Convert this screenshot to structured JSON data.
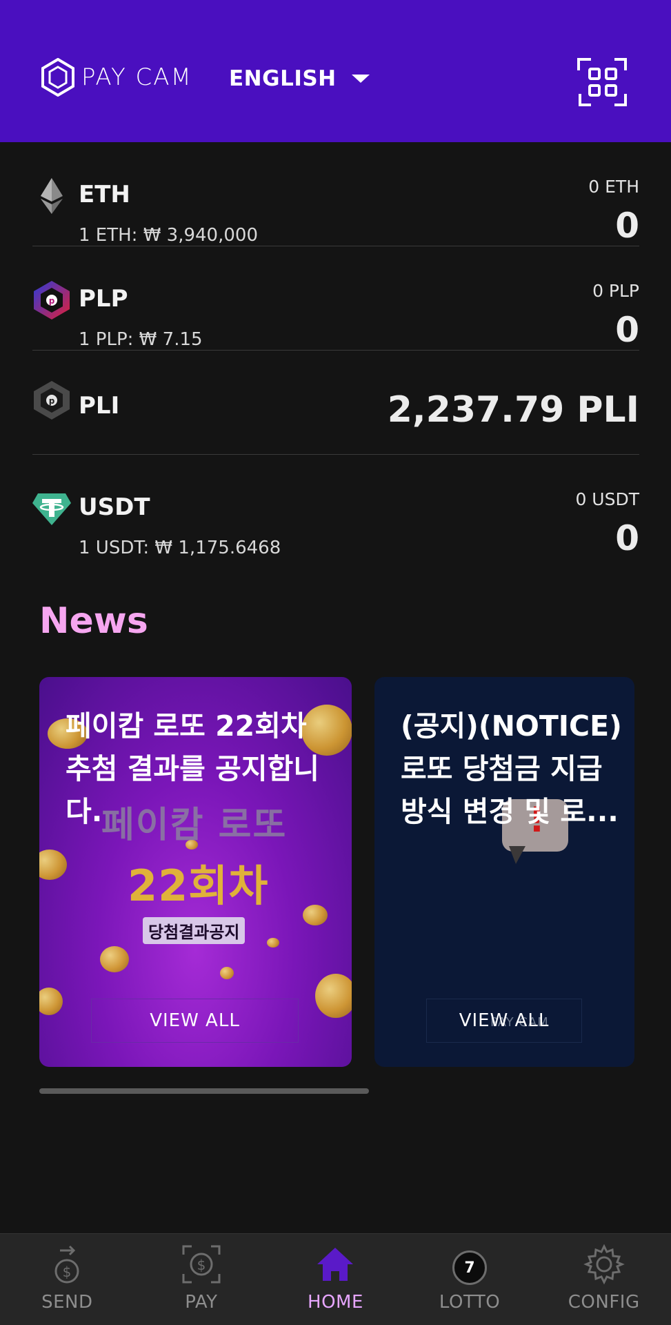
{
  "header": {
    "logo_text": "PAY CAM",
    "language": "ENGLISH",
    "qr_icon": "qr-scan-icon",
    "bg_color": "#4a0fbf"
  },
  "assets": [
    {
      "symbol": "ETH",
      "rate": "1 ETH: ₩ 3,940,000",
      "balance": "0 ETH",
      "krw_value": "0",
      "icon": "ethereum-icon"
    },
    {
      "symbol": "PLP",
      "rate": "1 PLP: ₩ 7.15",
      "balance": "0 PLP",
      "krw_value": "0",
      "icon": "plp-token-icon"
    },
    {
      "symbol": "PLI",
      "balance_big": "2,237.79 PLI",
      "icon": "pli-token-icon"
    },
    {
      "symbol": "USDT",
      "rate": "1 USDT: ₩ 1,175.6468",
      "balance": "0 USDT",
      "krw_value": "0",
      "icon": "tether-icon"
    }
  ],
  "news": {
    "title": "News",
    "title_color": "#f6a6f0",
    "cards": [
      {
        "text": "페이캄 로또 22회차 추첨 결과를 공지합니다.",
        "button": "VIEW ALL",
        "image_text_1": "페이캄 로또",
        "image_text_2": "22회차",
        "image_text_3": "당첨결과공지"
      },
      {
        "text": "(공지)(NOTICE) 로또 당첨금 지급 방식 변경 및 로...",
        "button": "VIEW ALL",
        "image_text_1": "PAY CAM"
      }
    ]
  },
  "bottom_nav": [
    {
      "label": "SEND",
      "icon": "send-money-icon",
      "active": false
    },
    {
      "label": "PAY",
      "icon": "pay-scan-icon",
      "active": false
    },
    {
      "label": "HOME",
      "icon": "home-icon",
      "active": true
    },
    {
      "label": "LOTTO",
      "icon": "lotto-ball-icon",
      "badge": "7",
      "active": false
    },
    {
      "label": "CONFIG",
      "icon": "gear-icon",
      "active": false
    }
  ],
  "accent_color": "#e7a6ff"
}
